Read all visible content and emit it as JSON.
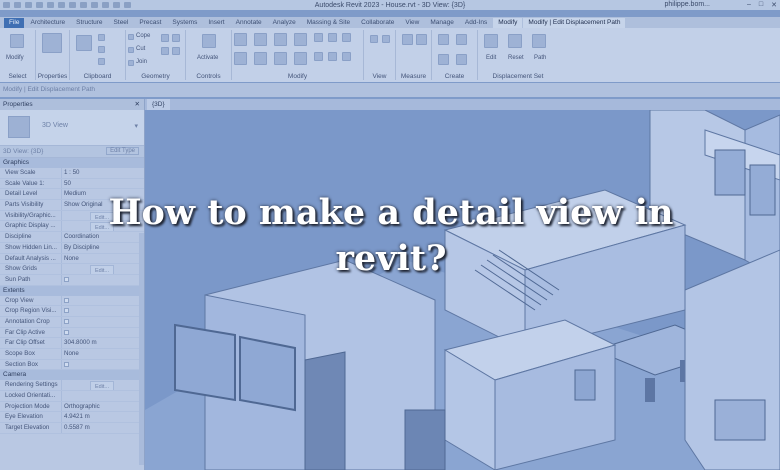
{
  "titlebar": {
    "app_title": "Autodesk Revit 2023 - House.rvt - 3D View: {3D}",
    "user": "philippe.bom...",
    "window_buttons": [
      "–",
      "□",
      "✕"
    ]
  },
  "tabs": [
    "File",
    "Architecture",
    "Structure",
    "Steel",
    "Precast",
    "Systems",
    "Insert",
    "Annotate",
    "Analyze",
    "Massing & Site",
    "Collaborate",
    "View",
    "Manage",
    "Add-Ins",
    "Modify",
    "Modify | Edit Displacement Path"
  ],
  "ribbon": {
    "panels": {
      "select": "Select",
      "properties": "Properties",
      "clipboard": "Clipboard",
      "geometry": "Geometry",
      "controls": "Controls",
      "modify": "Modify",
      "view": "View",
      "measure": "Measure",
      "create": "Create",
      "displacement_set": "Displacement Set"
    },
    "modify_label": "Modify",
    "activate_label": "Activate",
    "clipboard_items": [
      "Cope",
      "Cut",
      "Join"
    ],
    "displacement_items": [
      "Edit",
      "Reset",
      "Path"
    ]
  },
  "options_bar": {
    "text": "Modify | Edit Displacement Path"
  },
  "properties": {
    "title": "Properties",
    "close": "✕",
    "type_name": "3D View",
    "dropdown": "▾",
    "instance": "3D View: {3D}",
    "edit_type": "Edit Type",
    "groups": [
      {
        "name": "Graphics",
        "rows": [
          {
            "k": "View Scale",
            "v": "1 : 50"
          },
          {
            "k": "Scale Value    1:",
            "v": "50"
          },
          {
            "k": "Detail Level",
            "v": "Medium"
          },
          {
            "k": "Parts Visibility",
            "v": "Show Original"
          },
          {
            "k": "Visibility/Graphic...",
            "v": "",
            "btn": "Edit..."
          },
          {
            "k": "Graphic Display ...",
            "v": "",
            "btn": "Edit..."
          },
          {
            "k": "Discipline",
            "v": "Coordination"
          },
          {
            "k": "Show Hidden Lin...",
            "v": "By Discipline"
          },
          {
            "k": "Default Analysis ...",
            "v": "None"
          },
          {
            "k": "Show Grids",
            "v": "",
            "btn": "Edit..."
          },
          {
            "k": "Sun Path",
            "v": "",
            "cb": true
          }
        ]
      },
      {
        "name": "Extents",
        "rows": [
          {
            "k": "Crop View",
            "v": "",
            "cb": true
          },
          {
            "k": "Crop Region Visi...",
            "v": "",
            "cb": true
          },
          {
            "k": "Annotation Crop",
            "v": "",
            "cb": true
          },
          {
            "k": "Far Clip Active",
            "v": "",
            "cb": true
          },
          {
            "k": "Far Clip Offset",
            "v": "304.8000 m"
          },
          {
            "k": "Scope Box",
            "v": "None"
          },
          {
            "k": "Section Box",
            "v": "",
            "cb": true
          }
        ]
      },
      {
        "name": "Camera",
        "rows": [
          {
            "k": "Rendering Settings",
            "v": "",
            "btn": "Edit..."
          },
          {
            "k": "Locked Orientati...",
            "v": ""
          },
          {
            "k": "Projection Mode",
            "v": "Orthographic"
          },
          {
            "k": "Eye Elevation",
            "v": "4.9421 m"
          },
          {
            "k": "Target Elevation",
            "v": "0.5587 m"
          }
        ]
      }
    ]
  },
  "view_tab": "{3D}",
  "headline": "How to make a detail view in revit?"
}
